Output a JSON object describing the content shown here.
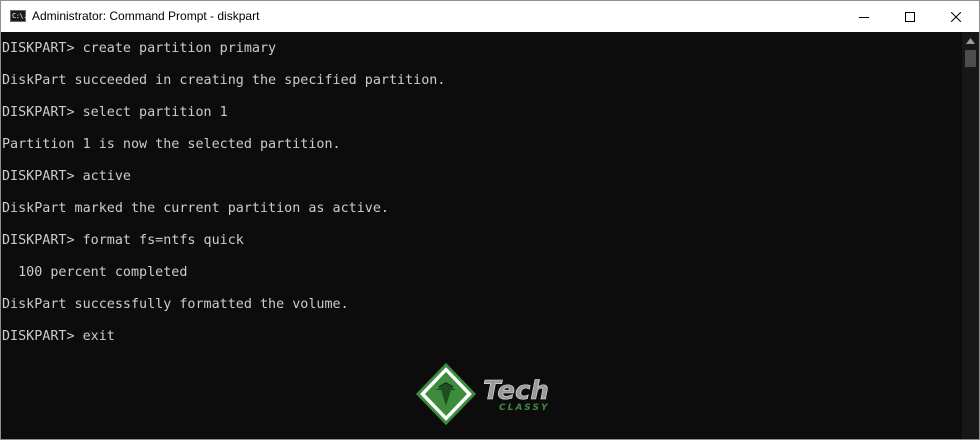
{
  "window": {
    "title": "Administrator: Command Prompt - diskpart",
    "icon": "cmd-app-icon",
    "icon_text": "C:\\."
  },
  "caption_buttons": {
    "minimize": "minimize-icon",
    "maximize": "maximize-icon",
    "close": "close-icon"
  },
  "console": {
    "lines": [
      "DISKPART> create partition primary",
      "DiskPart succeeded in creating the specified partition.",
      "DISKPART> select partition 1",
      "Partition 1 is now the selected partition.",
      "DISKPART> active",
      "DiskPart marked the current partition as active.",
      "DISKPART> format fs=ntfs quick",
      "  100 percent completed",
      "DiskPart successfully formatted the volume.",
      "DISKPART> exit"
    ],
    "text_color": "#cccccc",
    "background": "#0c0c0c"
  },
  "watermark": {
    "brand": "Tech",
    "tagline": "CLASSY",
    "colors": {
      "green": "#3d8b3d",
      "gray": "#9a9a9a"
    }
  }
}
